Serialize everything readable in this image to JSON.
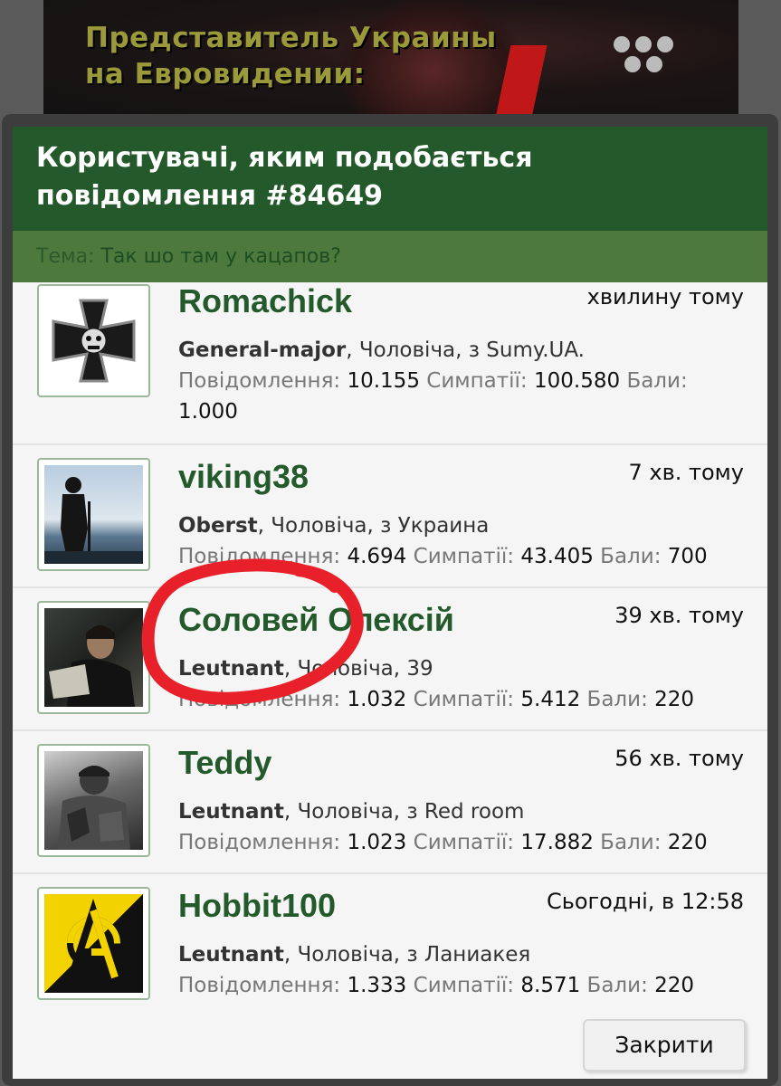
{
  "banner": {
    "line1": "Представитель Украины",
    "line2": "на Евровидении:"
  },
  "dialog": {
    "title": "Користувачі, яким подобається повідомлення #84649",
    "topic_label": "Тема:",
    "topic_value": "Так шо там у кацапов?",
    "close_label": "Закрити"
  },
  "labels": {
    "messages": "Повідомлення:",
    "likes": "Симпатії:",
    "points": "Бали:"
  },
  "users": [
    {
      "name": "Romachick",
      "time": "хвилину тому",
      "rank": "General-major",
      "info": ", Чоловіча, з Sumy.UA.",
      "messages": "10.155",
      "likes": "100.580",
      "points": "1.000",
      "avatar_icon": "iron-cross-skull-icon"
    },
    {
      "name": "viking38",
      "time": "7 хв. тому",
      "rank": "Oberst",
      "info": ", Чоловіча, з Украина",
      "messages": "4.694",
      "likes": "43.405",
      "points": "700",
      "avatar_icon": "viking-silhouette-photo"
    },
    {
      "name": "Соловей Олексій",
      "time": "39 хв. тому",
      "rank": "Leutnant",
      "info": ", Чоловіча, 39",
      "messages": "1.032",
      "likes": "5.412",
      "points": "220",
      "avatar_icon": "man-reading-photo"
    },
    {
      "name": "Teddy",
      "time": "56 хв. тому",
      "rank": "Leutnant",
      "info": ", Чоловіча, з Red room",
      "messages": "1.023",
      "likes": "17.882",
      "points": "220",
      "avatar_icon": "soldier-photo"
    },
    {
      "name": "Hobbit100",
      "time": "Сьогодні, в 12:58",
      "rank": "Leutnant",
      "info": ", Чоловіча, з Ланиакея",
      "messages": "1.333",
      "likes": "8.571",
      "points": "220",
      "avatar_icon": "anarchy-symbol-icon"
    }
  ],
  "colors": {
    "header": "#245a2b",
    "subheader": "#4d7a3c",
    "username": "#245a2b",
    "annotation": "#e8202a"
  }
}
